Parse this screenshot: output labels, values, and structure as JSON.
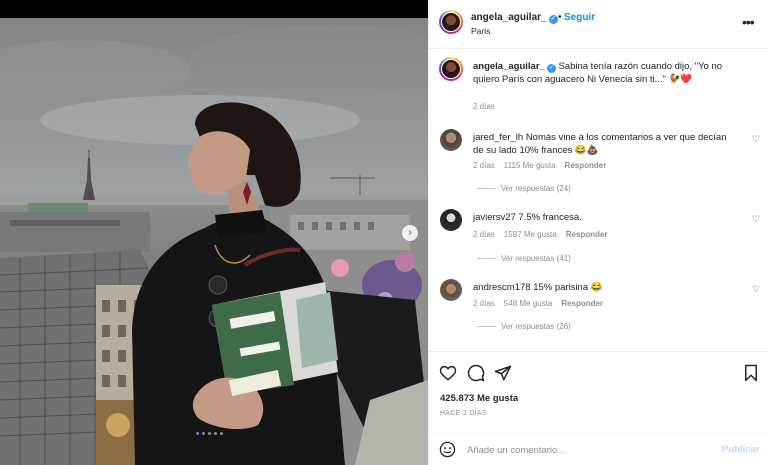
{
  "post": {
    "username": "angela_aguilar_",
    "follow_label": "Seguir",
    "separator": "•",
    "location": "Paris"
  },
  "caption": {
    "username": "angela_aguilar_",
    "text": "Sabina tenía razón cuando dijo, \"Yo no quiero París con aguacero Ni Venecia sin ti...\" 🐓❤️",
    "time": "2 días"
  },
  "comments": [
    {
      "username": "jared_fer_lh",
      "text": "Nomás vine a los comentarios a ver que decían de su lado 10% frances 😂💩",
      "time": "2 días",
      "likes": "1115 Me gusta",
      "reply": "Responder",
      "view_replies": "Ver respuestas (24)"
    },
    {
      "username": "javiersv27",
      "text": "7.5% francesa.",
      "time": "2 días",
      "likes": "1597 Me gusta",
      "reply": "Responder",
      "view_replies": "Ver respuestas (41)"
    },
    {
      "username": "andrescm178",
      "text": "15% parisina 😂",
      "time": "2 días",
      "likes": "548 Me gusta",
      "reply": "Responder",
      "view_replies": "Ver respuestas (26)"
    }
  ],
  "actions": {
    "likes": "425.873 Me gusta",
    "posted_ago": "HACE 2 DÍAS"
  },
  "add_comment": {
    "placeholder": "Añade un comentario...",
    "publish_label": "Publicar"
  },
  "colors": {
    "accent": "#0095f6",
    "verified": "#3897f0",
    "muted_text": "#8e8e8e",
    "publish_disabled": "#b2dffc"
  },
  "carousel": {
    "total": 5,
    "current": 1
  }
}
